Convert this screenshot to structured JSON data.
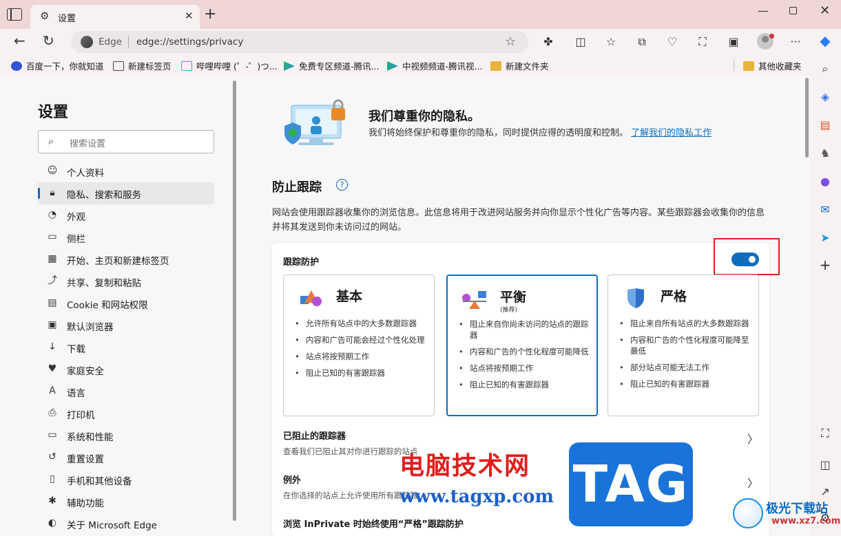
{
  "window": {
    "tab_title": "设置",
    "controls": {
      "minimize": "—",
      "close": "✕"
    }
  },
  "toolbar": {
    "address_brand": "Edge",
    "address_url": "edge://settings/privacy"
  },
  "bookmarks": [
    {
      "label": "百度一下，你就知道",
      "color": "#2f55d4"
    },
    {
      "label": "新建标签页",
      "color": "#444444"
    },
    {
      "label": "哔哩哔哩 (゜-゜)つ...",
      "color": "#23ade5"
    },
    {
      "label": "免费专区频道-腾讯...",
      "color": "#1bb760"
    },
    {
      "label": "中视频频道-腾讯视...",
      "color": "#1bb760"
    },
    {
      "label": "新建文件夹",
      "color": "#e8b43a"
    }
  ],
  "bookmarks_other": "其他收藏夹",
  "settings": {
    "title": "设置",
    "search_placeholder": "搜索设置",
    "nav": [
      {
        "label": "个人资料",
        "icon": "profile-icon"
      },
      {
        "label": "隐私、搜索和服务",
        "icon": "lock-icon",
        "active": true
      },
      {
        "label": "外观",
        "icon": "palette-icon"
      },
      {
        "label": "侧栏",
        "icon": "sidebar-icon"
      },
      {
        "label": "开始、主页和新建标签页",
        "icon": "home-icon"
      },
      {
        "label": "共享、复制和粘贴",
        "icon": "share-icon"
      },
      {
        "label": "Cookie 和网站权限",
        "icon": "cookie-icon"
      },
      {
        "label": "默认浏览器",
        "icon": "browser-icon"
      },
      {
        "label": "下载",
        "icon": "download-icon"
      },
      {
        "label": "家庭安全",
        "icon": "family-icon"
      },
      {
        "label": "语言",
        "icon": "language-icon"
      },
      {
        "label": "打印机",
        "icon": "printer-icon"
      },
      {
        "label": "系统和性能",
        "icon": "system-icon"
      },
      {
        "label": "重置设置",
        "icon": "reset-icon"
      },
      {
        "label": "手机和其他设备",
        "icon": "phone-icon"
      },
      {
        "label": "辅助功能",
        "icon": "accessibility-icon"
      },
      {
        "label": "关于 Microsoft Edge",
        "icon": "edge-icon"
      }
    ]
  },
  "main": {
    "hero_title": "我们尊重你的隐私。",
    "hero_desc": "我们将始终保护和尊重你的隐私，同时提供应得的透明度和控制。",
    "hero_link": "了解我们的隐私工作",
    "section_title": "防止跟踪",
    "section_desc": "网站会使用跟踪器收集你的浏览信息。此信息将用于改进网站服务并向你显示个性化广告等内容。某些跟踪器会收集你的信息并将其发送到你未访问过的网站。",
    "card_title": "跟踪防护",
    "toggle_on": true,
    "options": [
      {
        "name": "基本",
        "sub": "",
        "items": [
          "允许所有站点中的大多数跟踪器",
          "内容和广告可能会经过个性化处理",
          "站点将按预期工作",
          "阻止已知的有害跟踪器"
        ]
      },
      {
        "name": "平衡",
        "sub": "(推荐)",
        "selected": true,
        "items": [
          "阻止来自你尚未访问的站点的跟踪器",
          "内容和广告的个性化程度可能降低",
          "站点将按预期工作",
          "阻止已知的有害跟踪器"
        ]
      },
      {
        "name": "严格",
        "sub": "",
        "items": [
          "阻止来自所有站点的大多数跟踪器",
          "内容和广告的个性化程度可能降至最低",
          "部分站点可能无法工作",
          "阻止已知的有害跟踪器"
        ]
      }
    ],
    "rows": [
      {
        "title": "已阻止的跟踪器",
        "sub": "查看我们已阻止其对你进行跟踪的站点"
      },
      {
        "title": "例外",
        "sub": "在你选择的站点上允许使用所有跟踪器"
      },
      {
        "title": "浏览 InPrivate 时始终使用“严格”跟踪防护",
        "sub": ""
      }
    ]
  },
  "watermark": {
    "text": "电脑技术网",
    "url": "www.tagxp.com",
    "tag": "TAG",
    "logo_title": "极光下载站",
    "logo_sub": "www.xz7.com"
  },
  "colors": {
    "accent": "#0f6cbd",
    "tabstrip": "#efd7d7",
    "highlight": "#e01e1e"
  }
}
